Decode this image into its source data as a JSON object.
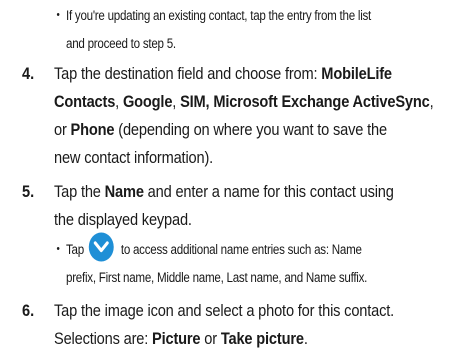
{
  "sub1": {
    "line1": "If you're updating an existing contact, tap the entry from the list",
    "line2": "and proceed to step 5."
  },
  "step4": {
    "number": "4.",
    "l1_pre": "Tap the destination field and choose from: ",
    "l1_b": "MobileLife",
    "l2_b1": "Contacts",
    "l2_c1": ", ",
    "l2_b2": "Google",
    "l2_c2": ", ",
    "l2_b3": "SIM, Microsoft Exchange ActiveSync",
    "l2_c3": ",",
    "l3_pre": "or ",
    "l3_b": "Phone",
    "l3_post": " (depending on where you want to save the",
    "l4": "new contact information)."
  },
  "step5": {
    "number": "5.",
    "l1_pre": "Tap the ",
    "l1_b": "Name",
    "l1_post": " and enter a name for this contact using",
    "l2": "the displayed keypad.",
    "sub_pre": "Tap",
    "sub_post": "to access additional name entries such as: Name",
    "sub_l2": "prefix, First name, Middle name, Last name, and Name suffix.",
    "chevron_icon": "chevron-down-circle-icon",
    "chevron_color": "#1f8fd6"
  },
  "step6": {
    "number": "6.",
    "l1": "Tap the image icon and select a photo for this contact.",
    "l2_pre": "Selections are: ",
    "l2_b1": "Picture",
    "l2_mid": " or ",
    "l2_b2": "Take picture",
    "l2_post": "."
  }
}
